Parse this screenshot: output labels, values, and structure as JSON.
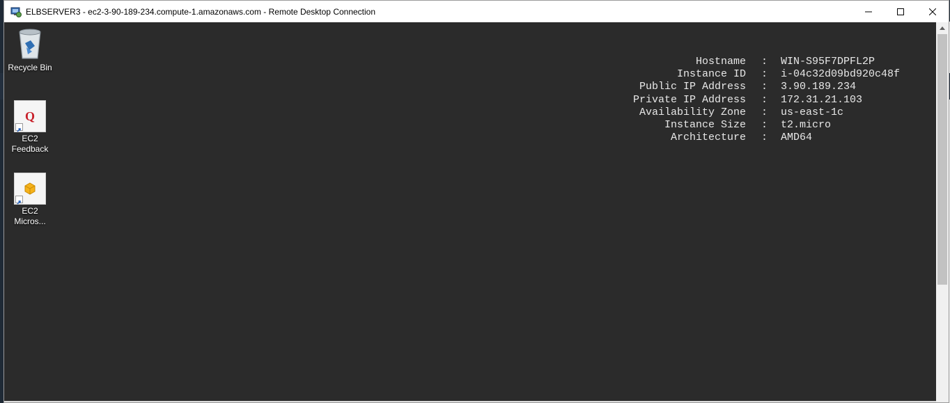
{
  "window": {
    "title": "ELBSERVER3 - ec2-3-90-189-234.compute-1.amazonaws.com - Remote Desktop Connection",
    "controls": {
      "minimize": "minimize-icon",
      "maximize": "maximize-icon",
      "close": "close-icon"
    }
  },
  "desktop_icons": [
    {
      "label": "Recycle Bin",
      "icon": "recycle-bin-icon"
    },
    {
      "label": "EC2\nFeedback",
      "line1": "EC2",
      "line2": "Feedback",
      "icon": "feedback-q-icon"
    },
    {
      "label": "EC2\nMicros...",
      "line1": "EC2",
      "line2": "Micros...",
      "icon": "aws-box-icon"
    }
  ],
  "instance_info": [
    {
      "label": "Hostname",
      "value": "WIN-S95F7DPFL2P"
    },
    {
      "label": "Instance ID",
      "value": "i-04c32d09bd920c48f"
    },
    {
      "label": "Public IP Address",
      "value": "3.90.189.234"
    },
    {
      "label": "Private IP Address",
      "value": "172.31.21.103"
    },
    {
      "label": "Availability Zone",
      "value": "us-east-1c"
    },
    {
      "label": "Instance Size",
      "value": "t2.micro"
    },
    {
      "label": "Architecture",
      "value": "AMD64"
    }
  ],
  "separator": ":",
  "colors": {
    "desktop_bg": "#2b2b2b",
    "text": "#e8e8e8",
    "titlebar_bg": "#ffffff"
  }
}
